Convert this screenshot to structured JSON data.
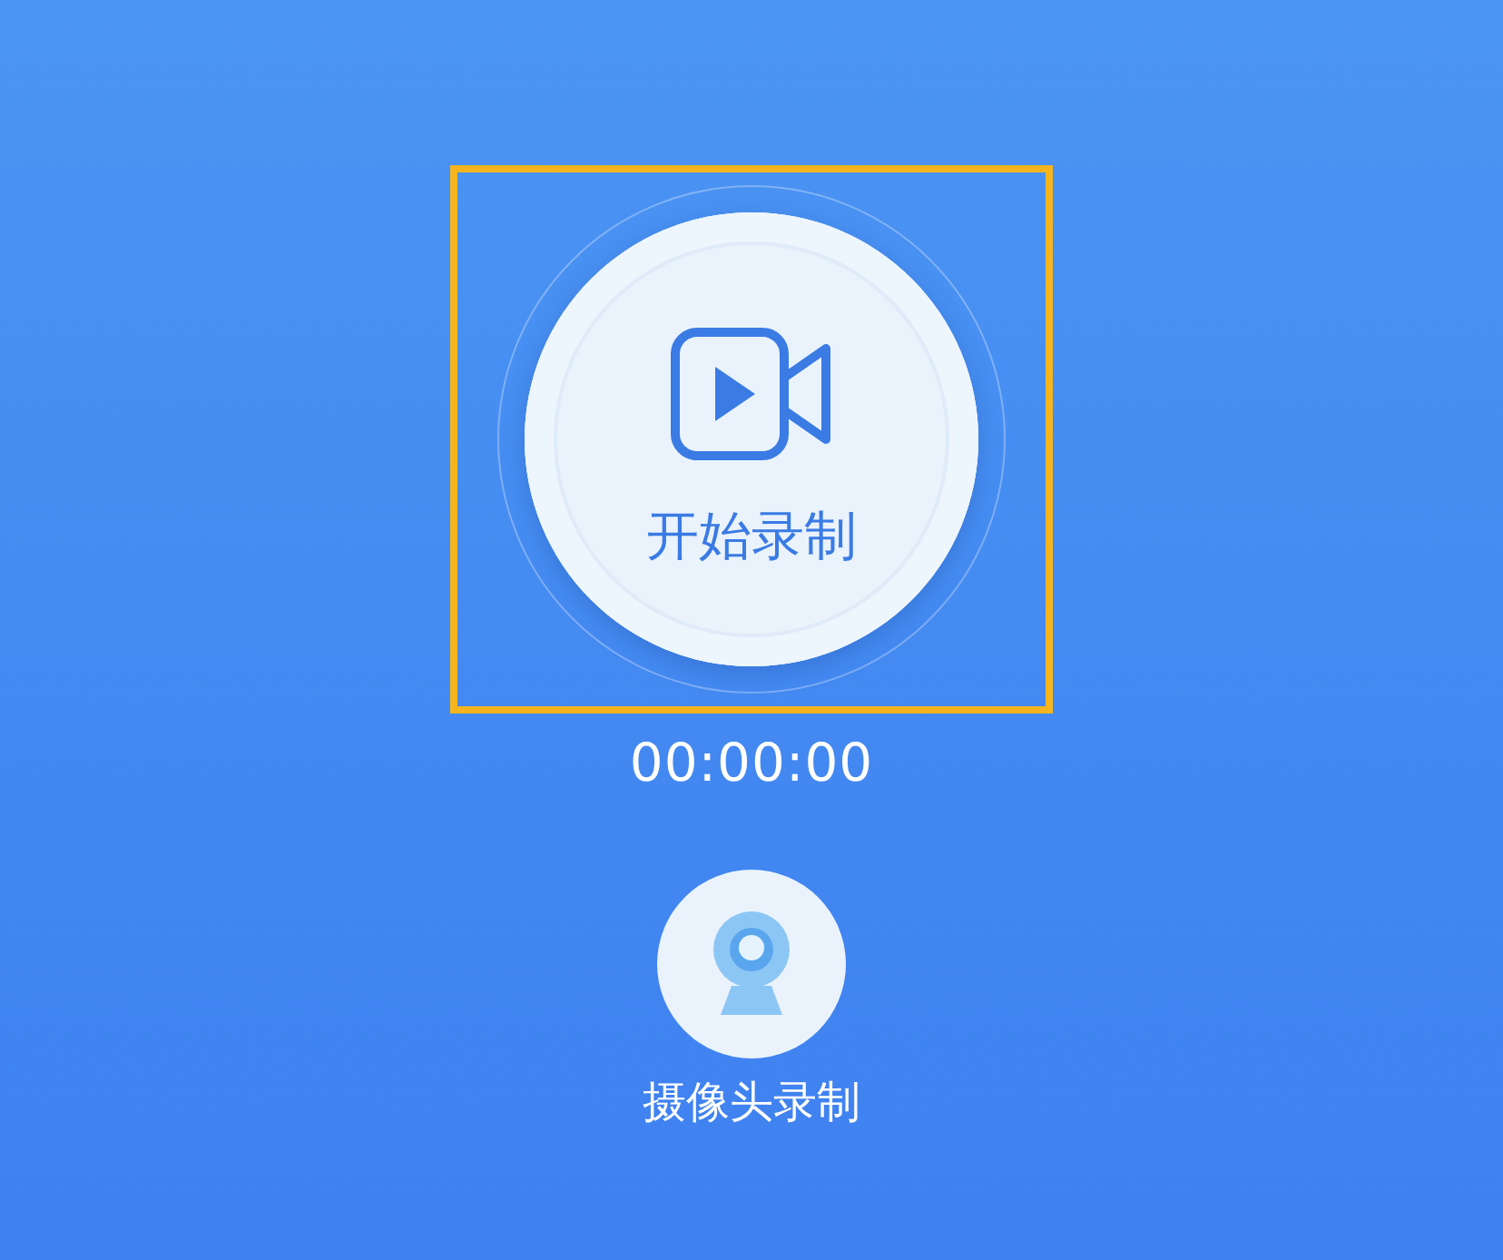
{
  "record_button": {
    "label": "开始录制",
    "highlighted": true
  },
  "timer": "00:00:00",
  "camera_button": {
    "label": "摄像头录制"
  }
}
